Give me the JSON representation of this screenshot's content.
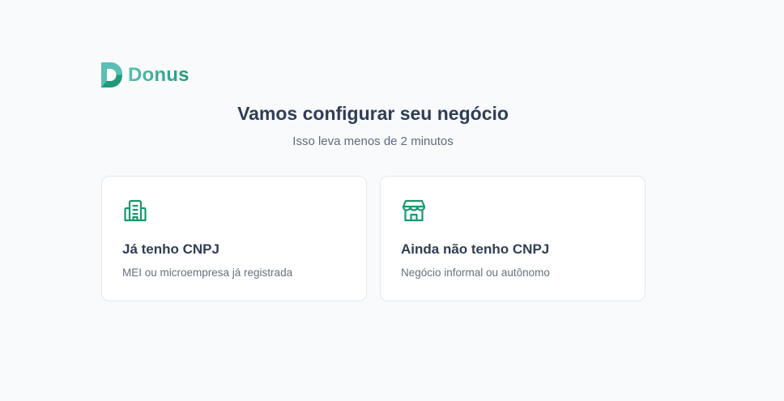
{
  "brand": {
    "name": "Donus",
    "icon": "donus-logo-icon",
    "accent": "#1f9a7a"
  },
  "header": {
    "title": "Vamos configurar seu negócio",
    "subtitle": "Isso leva menos de 2 minutos"
  },
  "options": [
    {
      "icon": "building-icon",
      "title": "Já tenho CNPJ",
      "description": "MEI ou microempresa já registrada"
    },
    {
      "icon": "store-icon",
      "title": "Ainda não tenho CNPJ",
      "description": "Negócio informal ou autônomo"
    }
  ],
  "colors": {
    "icon": "#159a6e",
    "title": "#2f3e55",
    "background": "#f8fafc"
  }
}
